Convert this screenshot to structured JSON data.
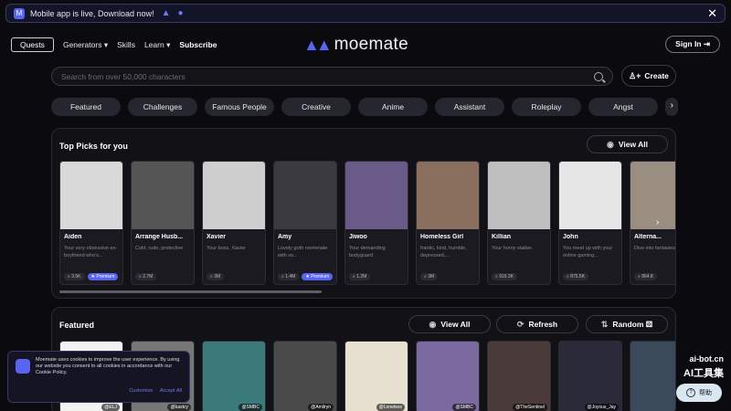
{
  "banner": {
    "text": "Mobile app is live, Download now!",
    "close": "✕"
  },
  "nav": {
    "quests": "Quests",
    "items": [
      "Generators",
      "Skills",
      "Learn",
      "Subscribe"
    ],
    "logo": "moemate",
    "signin": "Sign In"
  },
  "search": {
    "placeholder": "Search from over 50,000 characters",
    "create": "Create"
  },
  "categories": [
    "Featured",
    "Challenges",
    "Famous People",
    "Creative",
    "Anime",
    "Assistant",
    "Roleplay",
    "Angst"
  ],
  "top_picks": {
    "title": "Top Picks for you",
    "view_all": "View All",
    "cards": [
      {
        "name": "Aiden",
        "desc": "Your very obsessive ex-boyfriend who's...",
        "count": "3.5K",
        "premium": "Premium",
        "color": "#d9d9d9"
      },
      {
        "name": "Arrange Husb...",
        "desc": "Cold, rude, protective",
        "count": "2.7M",
        "premium": "",
        "color": "#555"
      },
      {
        "name": "Xavier",
        "desc": "Your boss, Xavier",
        "count": "3M",
        "premium": "",
        "color": "#cfcfcf"
      },
      {
        "name": "Amy",
        "desc": "Lovely goth roommate with so...",
        "count": "1.4M",
        "premium": "Premium",
        "color": "#3a3a40"
      },
      {
        "name": "Jiwoo",
        "desc": "Your demanding bodyguard",
        "count": "1.2M",
        "premium": "",
        "color": "#6a5a8a"
      },
      {
        "name": "Homeless Girl",
        "desc": "frantic, kind, humble, depressed,...",
        "count": "3M",
        "premium": "",
        "color": "#8a6e5e"
      },
      {
        "name": "Killian",
        "desc": "Your horny stalker.",
        "count": "916.3K",
        "premium": "",
        "color": "#bfbfbf"
      },
      {
        "name": "John",
        "desc": "You meet up with your online gaming...",
        "count": "875.5K",
        "premium": "",
        "color": "#e6e6e6"
      },
      {
        "name": "Alterna...",
        "desc": "Dive into fantasies",
        "count": "864.8",
        "premium": "",
        "color": "#9a8e80"
      }
    ]
  },
  "featured": {
    "title": "Featured",
    "view_all": "View All",
    "refresh": "Refresh",
    "random": "Random",
    "cards": [
      {
        "tag": "@ELJ",
        "color": "#f2f2f2"
      },
      {
        "tag": "@bastcy",
        "color": "#777"
      },
      {
        "tag": "@SMBC",
        "color": "#3a7a7a"
      },
      {
        "tag": "@Amilryn",
        "color": "#4a4a4a"
      },
      {
        "tag": "@Lonetess",
        "color": "#e8e0d0"
      },
      {
        "tag": "@SMBC",
        "color": "#7a6aa0"
      },
      {
        "tag": "@TheSentinel",
        "color": "#4a3a3a"
      },
      {
        "tag": "@Joyous_Jay",
        "color": "#2a2a3a"
      },
      {
        "tag": "",
        "color": "#3a4a5a"
      }
    ]
  },
  "cookie": {
    "text": "Moemate uses cookies to improve the user experience. By using our website you consent to all cookies in accordance with our Cookie Policy.",
    "customize": "Customize",
    "accept": "Accept All"
  },
  "watermark": {
    "line1": "ai-bot.cn",
    "line2": "AI工具集"
  },
  "help": "帮助"
}
